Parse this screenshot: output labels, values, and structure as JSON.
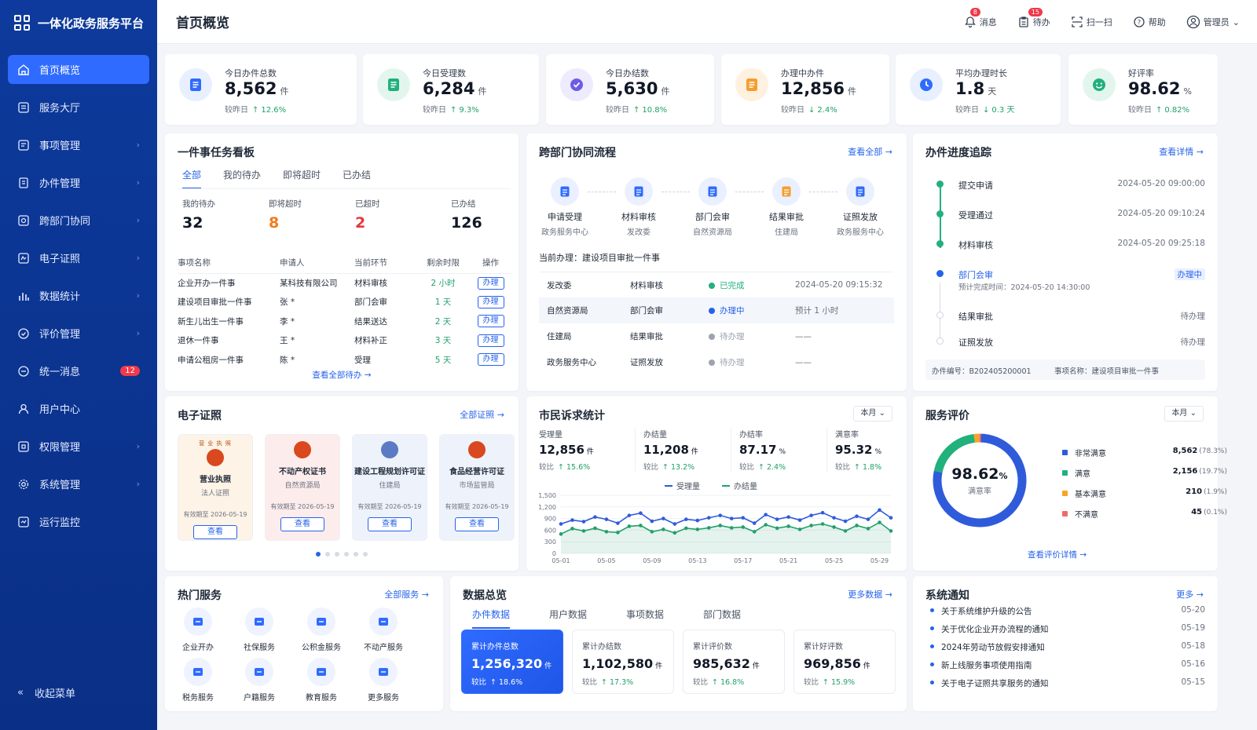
{
  "app": {
    "title": "一体化政务服务平台"
  },
  "sidebar": {
    "items": [
      {
        "label": "首页概览",
        "icon": "home-icon",
        "active": true
      },
      {
        "label": "服务大厅",
        "icon": "hall-icon"
      },
      {
        "label": "事项管理",
        "icon": "list-icon",
        "arrow": true
      },
      {
        "label": "办件管理",
        "icon": "file-icon",
        "arrow": true
      },
      {
        "label": "跨部门协同",
        "icon": "collab-icon",
        "arrow": true
      },
      {
        "label": "电子证照",
        "icon": "cert-icon",
        "arrow": true
      },
      {
        "label": "数据统计",
        "icon": "bar-chart-icon",
        "arrow": true
      },
      {
        "label": "评价管理",
        "icon": "check-circle-icon",
        "arrow": true
      },
      {
        "label": "统一消息",
        "icon": "message-icon",
        "badge": "12"
      },
      {
        "label": "用户中心",
        "icon": "user-icon"
      },
      {
        "label": "权限管理",
        "icon": "permission-icon",
        "arrow": true
      },
      {
        "label": "系统管理",
        "icon": "gear-icon",
        "arrow": true
      },
      {
        "label": "运行监控",
        "icon": "monitor-icon"
      }
    ],
    "collapse": "收起菜单"
  },
  "header": {
    "title": "首页概览",
    "tools": {
      "msg": "消息",
      "msg_badge": "8",
      "todo": "待办",
      "todo_badge": "15",
      "scan": "扫一扫",
      "help": "帮助",
      "user": "管理员"
    }
  },
  "stats": [
    {
      "label": "今日办件总数",
      "value": "8,562",
      "unit": "件",
      "cmp": "较昨日",
      "dir": "↑",
      "delta": "12.6%",
      "color": "#2f6bff",
      "bg": "#e8efff"
    },
    {
      "label": "今日受理数",
      "value": "6,284",
      "unit": "件",
      "cmp": "较昨日",
      "dir": "↑",
      "delta": "9.3%",
      "color": "#22b07d",
      "bg": "#e3f6ee"
    },
    {
      "label": "今日办结数",
      "value": "5,630",
      "unit": "件",
      "cmp": "较昨日",
      "dir": "↑",
      "delta": "10.8%",
      "color": "#6c5ce7",
      "bg": "#eeebff"
    },
    {
      "label": "办理中办件",
      "value": "12,856",
      "unit": "件",
      "cmp": "较昨日",
      "dir": "↓",
      "delta": "2.4%",
      "color": "#f59e2e",
      "bg": "#fff1df"
    },
    {
      "label": "平均办理时长",
      "value": "1.8",
      "unit": "天",
      "cmp": "较昨日",
      "dir": "↓",
      "delta": "0.3 天",
      "color": "#2f6bff",
      "bg": "#e8efff"
    },
    {
      "label": "好评率",
      "value": "98.62",
      "unit": "%",
      "cmp": "较昨日",
      "dir": "↑",
      "delta": "0.82%",
      "color": "#22b07d",
      "bg": "#e3f6ee"
    }
  ],
  "task": {
    "title": "一件事任务看板",
    "tabs": [
      "全部",
      "我的待办",
      "即将超时",
      "已办结"
    ],
    "counts": [
      {
        "label": "我的待办",
        "value": "32",
        "color": "#111827"
      },
      {
        "label": "即将超时",
        "value": "8",
        "color": "#f07c1b"
      },
      {
        "label": "已超时",
        "value": "2",
        "color": "#e5383b"
      },
      {
        "label": "已办结",
        "value": "126",
        "color": "#111827"
      }
    ],
    "headers": [
      "事项名称",
      "申请人",
      "当前环节",
      "剩余时限",
      "操作"
    ],
    "rows": [
      [
        "企业开办一件事",
        "某科技有限公司",
        "材料审核",
        "2 小时",
        "办理"
      ],
      [
        "建设项目审批一件事",
        "张 *",
        "部门会审",
        "1 天",
        "办理"
      ],
      [
        "新生儿出生一件事",
        "李 *",
        "结果送达",
        "2 天",
        "办理"
      ],
      [
        "退休一件事",
        "王 *",
        "材料补正",
        "3 天",
        "办理"
      ],
      [
        "申请公租房一件事",
        "陈 *",
        "受理",
        "5 天",
        "办理"
      ]
    ],
    "more": "查看全部待办 →"
  },
  "flow": {
    "title": "跨部门协同流程",
    "more": "查看全部 →",
    "steps": [
      {
        "name": "申请受理",
        "dept": "政务服务中心"
      },
      {
        "name": "材料审核",
        "dept": "发改委"
      },
      {
        "name": "部门会审",
        "dept": "自然资源局"
      },
      {
        "name": "结果审批",
        "dept": "住建局"
      },
      {
        "name": "证照发放",
        "dept": "政务服务中心"
      }
    ],
    "current": "当前办理：建设项目审批一件事",
    "rows": [
      {
        "dept": "发改委",
        "step": "材料审核",
        "status": "已完成",
        "time": "2024-05-20 09:15:32",
        "color": "#22b07d"
      },
      {
        "dept": "自然资源局",
        "step": "部门会审",
        "status": "办理中",
        "time": "预计 1 小时",
        "color": "#2563eb"
      },
      {
        "dept": "住建局",
        "step": "结果审批",
        "status": "待办理",
        "time": "——",
        "color": "#9ca3af"
      },
      {
        "dept": "政务服务中心",
        "step": "证照发放",
        "status": "待办理",
        "time": "——",
        "color": "#9ca3af"
      }
    ]
  },
  "progress": {
    "title": "办件进度追踪",
    "more": "查看详情 →",
    "items": [
      {
        "name": "提交申请",
        "date": "2024-05-20 09:00:00",
        "state": "done"
      },
      {
        "name": "受理通过",
        "date": "2024-05-20 09:10:24",
        "state": "done"
      },
      {
        "name": "材料审核",
        "date": "2024-05-20 09:25:18",
        "state": "done"
      },
      {
        "name": "部门会审",
        "date": "办理中",
        "state": "current",
        "sub": "预计完成时间：2024-05-20 14:30:00"
      },
      {
        "name": "结果审批",
        "date": "待办理",
        "state": "todo"
      },
      {
        "name": "证照发放",
        "date": "待办理",
        "state": "todo"
      }
    ],
    "no": "办件编号：B202405200001",
    "item": "事项名称：建设项目审批一件事"
  },
  "certs": {
    "title": "电子证照",
    "more": "全部证照 →",
    "items": [
      {
        "name": "营业执照",
        "dept": "法人证照",
        "valid": "有效期至 2026-05-19",
        "btn": "查看",
        "bg": "#fdf3e7",
        "ec": "#d9481e",
        "head": "营 业 执 照"
      },
      {
        "name": "不动产权证书",
        "dept": "自然资源局",
        "valid": "有效期至 2026-05-19",
        "btn": "查看",
        "bg": "#fdecec",
        "ec": "#d9481e"
      },
      {
        "name": "建设工程规划许可证",
        "dept": "住建局",
        "valid": "有效期至 2026-05-19",
        "btn": "查看",
        "bg": "#eef2fb",
        "ec": "#5b7cc4"
      },
      {
        "name": "食品经营许可证",
        "dept": "市场监管局",
        "valid": "有效期至 2026-05-19",
        "btn": "查看",
        "bg": "#eef3fb",
        "ec": "#d9481e"
      }
    ]
  },
  "appeal": {
    "title": "市民诉求统计",
    "select": "本月",
    "metrics": [
      {
        "label": "受理量",
        "value": "12,856",
        "unit": "件",
        "cmp": "较比",
        "delta": "↑ 15.6%"
      },
      {
        "label": "办结量",
        "value": "11,208",
        "unit": "件",
        "cmp": "较比",
        "delta": "↑ 13.2%"
      },
      {
        "label": "办结率",
        "value": "87.17",
        "unit": "%",
        "cmp": "较比",
        "delta": "↑ 2.4%"
      },
      {
        "label": "满意率",
        "value": "95.32",
        "unit": "%",
        "cmp": "较比",
        "delta": "↑ 1.8%"
      }
    ]
  },
  "chart_data": {
    "type": "line",
    "x": [
      "05-01",
      "05-02",
      "05-03",
      "05-04",
      "05-05",
      "05-06",
      "05-07",
      "05-08",
      "05-09",
      "05-10",
      "05-11",
      "05-12",
      "05-13",
      "05-14",
      "05-15",
      "05-16",
      "05-17",
      "05-18",
      "05-19",
      "05-20",
      "05-21",
      "05-22",
      "05-23",
      "05-24",
      "05-25",
      "05-26",
      "05-27",
      "05-28",
      "05-29",
      "05-30"
    ],
    "xticks": [
      "05-01",
      "05-05",
      "05-09",
      "05-13",
      "05-17",
      "05-21",
      "05-25",
      "05-29"
    ],
    "yticks": [
      "1,500",
      "1,200",
      "900",
      "600",
      "300",
      "0"
    ],
    "ylim": [
      0,
      1500
    ],
    "series": [
      {
        "name": "受理量",
        "color": "#2f5bdb",
        "values": [
          760,
          860,
          820,
          940,
          880,
          780,
          980,
          1040,
          830,
          900,
          760,
          880,
          850,
          920,
          980,
          900,
          920,
          780,
          1000,
          880,
          940,
          860,
          980,
          1050,
          920,
          830,
          960,
          880,
          1120,
          920
        ]
      },
      {
        "name": "办结量",
        "color": "#22a06b",
        "values": [
          500,
          640,
          580,
          650,
          560,
          540,
          700,
          720,
          560,
          620,
          530,
          650,
          620,
          660,
          720,
          660,
          680,
          560,
          740,
          650,
          700,
          620,
          720,
          760,
          680,
          580,
          720,
          640,
          800,
          580
        ]
      }
    ]
  },
  "rating": {
    "title": "服务评价",
    "select": "本月",
    "value": "98.62",
    "unit": "%",
    "sub": "满意率",
    "more": "查看评价详情 →",
    "legend": [
      {
        "name": "非常满意",
        "value": "8,562",
        "pct": "(78.3%)",
        "color": "#2f5bdb",
        "frac": 0.783
      },
      {
        "name": "满意",
        "value": "2,156",
        "pct": "(19.7%)",
        "color": "#22b07d",
        "frac": 0.197
      },
      {
        "name": "基本满意",
        "value": "210",
        "pct": "(1.9%)",
        "color": "#f5a524",
        "frac": 0.019
      },
      {
        "name": "不满意",
        "value": "45",
        "pct": "(0.1%)",
        "color": "#ef6b6b",
        "frac": 0.001
      }
    ]
  },
  "hot": {
    "title": "热门服务",
    "more": "全部服务 →",
    "items": [
      "企业开办",
      "社保服务",
      "公积金服务",
      "不动产服务",
      "税务服务",
      "户籍服务",
      "教育服务",
      "更多服务"
    ]
  },
  "overview": {
    "title": "数据总览",
    "more": "更多数据 →",
    "tabs": [
      "办件数据",
      "用户数据",
      "事项数据",
      "部门数据"
    ],
    "cards": [
      {
        "label": "累计办件总数",
        "value": "1,256,320",
        "unit": "件",
        "cmp": "较比",
        "delta": "↑ 18.6%"
      },
      {
        "label": "累计办结数",
        "value": "1,102,580",
        "unit": "件",
        "cmp": "较比",
        "delta": "↑ 17.3%"
      },
      {
        "label": "累计评价数",
        "value": "985,632",
        "unit": "件",
        "cmp": "较比",
        "delta": "↑ 16.8%"
      },
      {
        "label": "累计好评数",
        "value": "969,856",
        "unit": "件",
        "cmp": "较比",
        "delta": "↑ 15.9%"
      }
    ]
  },
  "notice": {
    "title": "系统通知",
    "more": "更多 →",
    "items": [
      {
        "text": "关于系统维护升级的公告",
        "date": "05-20"
      },
      {
        "text": "关于优化企业开办流程的通知",
        "date": "05-19"
      },
      {
        "text": "2024年劳动节放假安排通知",
        "date": "05-18"
      },
      {
        "text": "新上线服务事项使用指南",
        "date": "05-16"
      },
      {
        "text": "关于电子证照共享服务的通知",
        "date": "05-15"
      }
    ]
  }
}
